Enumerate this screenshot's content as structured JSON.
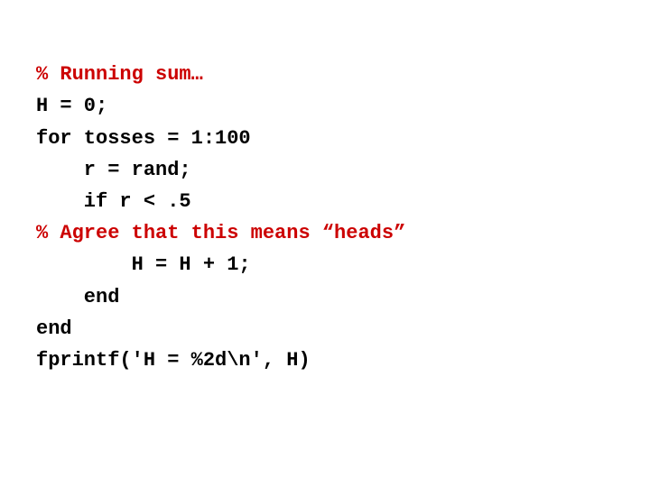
{
  "code": {
    "lines": [
      {
        "id": "line1",
        "type": "comment",
        "text": "% Running sum…"
      },
      {
        "id": "line2",
        "type": "code",
        "text": "H = 0;"
      },
      {
        "id": "line3",
        "type": "code",
        "text": "for tosses = 1:100"
      },
      {
        "id": "line4",
        "type": "code",
        "text": "    r = rand;"
      },
      {
        "id": "line5",
        "type": "code",
        "text": "    if r < .5"
      },
      {
        "id": "line6",
        "type": "comment",
        "text": "% Agree that this means “heads”"
      },
      {
        "id": "line7",
        "type": "code",
        "text": "        H = H + 1;"
      },
      {
        "id": "line8",
        "type": "code",
        "text": "    end"
      },
      {
        "id": "line9",
        "type": "code",
        "text": "end"
      },
      {
        "id": "line10",
        "type": "code",
        "text": "fprintf('H = %2d\\n', H)"
      }
    ]
  }
}
